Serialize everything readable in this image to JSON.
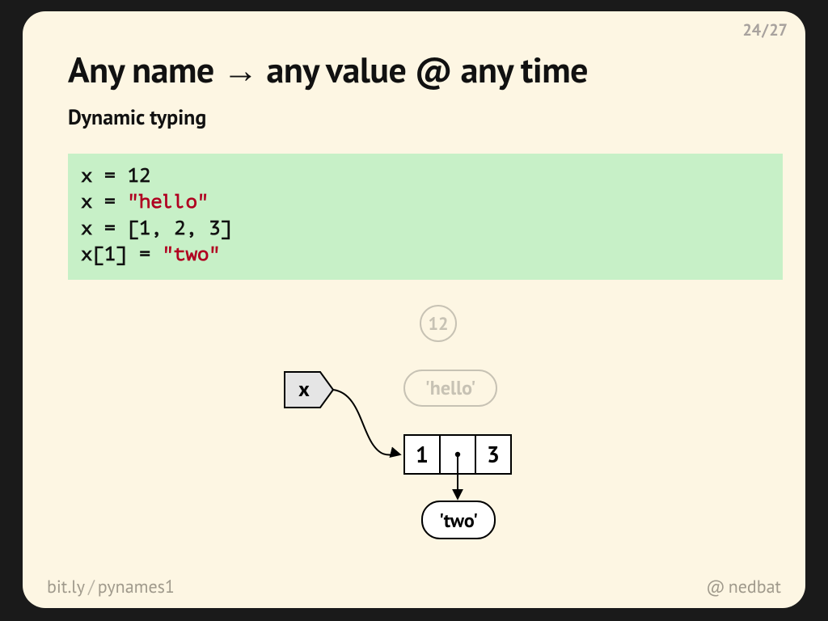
{
  "pager": {
    "current": "24",
    "total": "27",
    "slash": "/"
  },
  "title": "Any name → any value @ any time",
  "subtitle": "Dynamic typing",
  "code": {
    "line1_pre": "x = ",
    "line1_num": "12",
    "line2_pre": "x = ",
    "line2_str": "\"hello\"",
    "line3_pre": "x = [",
    "line3_n1": "1",
    "line3_s1": ", ",
    "line3_n2": "2",
    "line3_s2": ", ",
    "line3_n3": "3",
    "line3_post": "]",
    "line4_pre": "x[",
    "line4_idx": "1",
    "line4_mid": "] = ",
    "line4_str": "\"two\""
  },
  "diagram": {
    "tag_x": "x",
    "ghost_12": "12",
    "ghost_hello": "'hello'",
    "cell1": "1",
    "cell3": "3",
    "two": "'two'"
  },
  "footer": {
    "shortlink_domain": "bit.ly",
    "shortlink_slash": "/",
    "shortlink_path": "pynames1",
    "handle_at": "@",
    "handle_name": "nedbat"
  }
}
